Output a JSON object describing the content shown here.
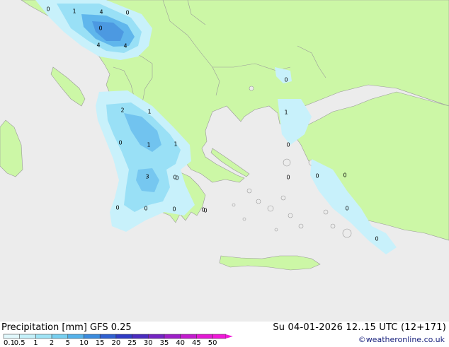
{
  "title": "Precipitation [mm]  GFS 0.25",
  "datetime": "Su 04-01-2026 12..15 UTC (12+171)",
  "credit": "©weatheronline.co.uk",
  "colors": {
    "sea": "#ececec",
    "land": "#ccf7a6",
    "border": "#9a9a9a",
    "precip_light": "#c8f1fb",
    "precip_mid": "#99e0f6",
    "precip_heavy": "#5fb6ec",
    "precip_max": "#3c82d9"
  },
  "legend": {
    "labels": [
      "0.1",
      "0.5",
      "1",
      "2",
      "5",
      "10",
      "15",
      "20",
      "25",
      "30",
      "35",
      "40",
      "45",
      "50"
    ],
    "colors": [
      "#e1f8fc",
      "#c4f0f9",
      "#9fe3f5",
      "#78cff0",
      "#55b2ea",
      "#3b8bdd",
      "#2f60cf",
      "#2f3bc4",
      "#4a2bbf",
      "#7423c2",
      "#9d1ec7",
      "#c21bcd",
      "#e218d3",
      "#f018d8"
    ]
  },
  "values": [
    {
      "label": "0"
    },
    {
      "label": "1"
    },
    {
      "label": "4"
    },
    {
      "label": "0"
    },
    {
      "label": "4"
    },
    {
      "label": "4"
    },
    {
      "label": "0"
    },
    {
      "label": "2"
    },
    {
      "label": "1"
    },
    {
      "label": "0"
    },
    {
      "label": "1"
    },
    {
      "label": "1"
    },
    {
      "label": "0"
    },
    {
      "label": "3"
    },
    {
      "label": "0"
    },
    {
      "label": "0"
    },
    {
      "label": "0"
    },
    {
      "label": "0"
    },
    {
      "label": "0"
    },
    {
      "label": "0"
    },
    {
      "label": "1"
    },
    {
      "label": "0"
    },
    {
      "label": "0"
    },
    {
      "label": "0"
    },
    {
      "label": "0"
    },
    {
      "label": "0"
    },
    {
      "label": "0"
    },
    {
      "label": "0"
    }
  ]
}
